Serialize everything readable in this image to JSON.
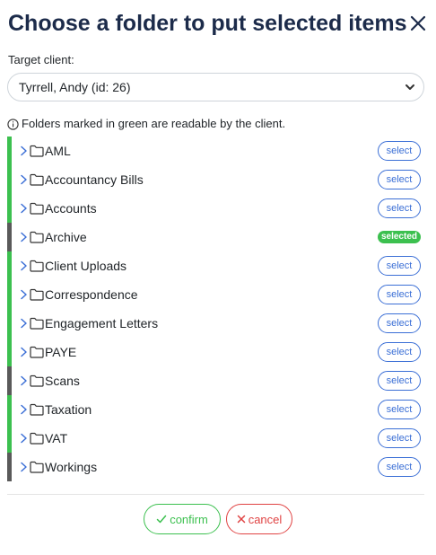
{
  "dialog": {
    "title": "Choose a folder to put selected items",
    "target_label": "Target client:",
    "client_select": {
      "value": "Tyrrell, Andy (id: 26)"
    },
    "info_text": "Folders marked in green are readable by the client."
  },
  "folders": [
    {
      "name": "AML",
      "readable": true,
      "action": "select"
    },
    {
      "name": "Accountancy Bills",
      "readable": true,
      "action": "select"
    },
    {
      "name": "Accounts",
      "readable": true,
      "action": "select"
    },
    {
      "name": "Archive",
      "readable": false,
      "action": "selected"
    },
    {
      "name": "Client Uploads",
      "readable": true,
      "action": "select"
    },
    {
      "name": "Correspondence",
      "readable": true,
      "action": "select"
    },
    {
      "name": "Engagement Letters",
      "readable": true,
      "action": "select"
    },
    {
      "name": "PAYE",
      "readable": true,
      "action": "select"
    },
    {
      "name": "Scans",
      "readable": false,
      "action": "select"
    },
    {
      "name": "Taxation",
      "readable": true,
      "action": "select"
    },
    {
      "name": "VAT",
      "readable": true,
      "action": "select"
    },
    {
      "name": "Workings",
      "readable": false,
      "action": "select"
    }
  ],
  "footer": {
    "confirm_label": "confirm",
    "cancel_label": "cancel"
  },
  "colors": {
    "readable": "#3cc04f",
    "not_readable": "#5a5a5a",
    "select_blue": "#3b6fd6",
    "cancel_red": "#e04343",
    "title": "#1c2b4a"
  },
  "icons": {
    "close": "close-icon",
    "expand": "chevron-right-icon",
    "folder": "folder-icon",
    "info": "info-icon",
    "dropdown": "chevron-down-icon",
    "confirm": "check-icon",
    "cancel": "x-icon"
  }
}
